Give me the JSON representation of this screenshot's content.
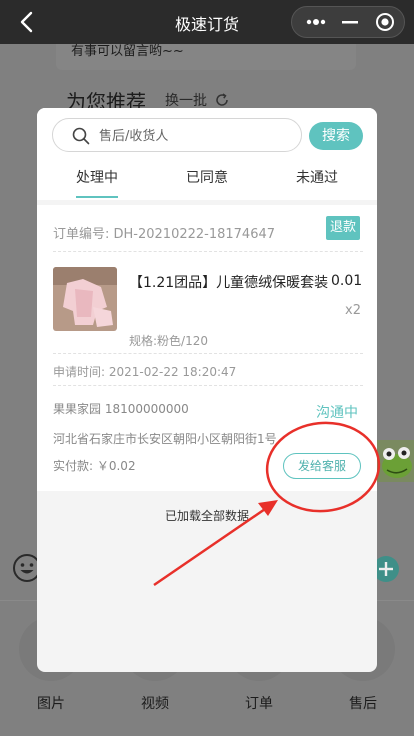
{
  "nav": {
    "title": "极速订货"
  },
  "background": {
    "message_hint": "有事可以留言哟~~",
    "recommend_title": "为您推荐",
    "refresh_label": "换一批",
    "bottom_tabs": [
      {
        "label": "图片"
      },
      {
        "label": "视频"
      },
      {
        "label": "订单"
      },
      {
        "label": "售后"
      }
    ]
  },
  "modal": {
    "search": {
      "placeholder": "售后/收货人",
      "button_label": "搜索"
    },
    "tabs": [
      {
        "label": "处理中",
        "active": true
      },
      {
        "label": "已同意",
        "active": false
      },
      {
        "label": "未通过",
        "active": false
      }
    ],
    "order": {
      "order_no": "订单编号: DH-20210222-18174647",
      "tag": "退款",
      "product_name": "【1.21团品】儿童德绒保暖套装",
      "price": "0.01",
      "qty": "x2",
      "spec": "规格:粉色/120",
      "apply_time": "申请时间: 2021-02-22 18:20:47",
      "buyer": "果果家园 18100000000",
      "status": "沟通中",
      "address": "河北省石家庄市长安区朝阳小区朝阳街1号",
      "paid": "实付款: ￥0.02",
      "send_button": "发给客服"
    },
    "loaded_text": "已加载全部数据"
  },
  "colors": {
    "accent": "#5fc3bf",
    "annotation": "#e8302a",
    "nav_bg": "#2b2b2b"
  }
}
